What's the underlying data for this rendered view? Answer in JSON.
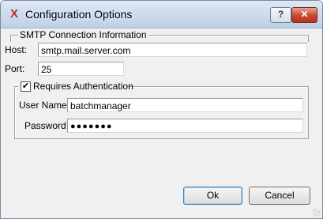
{
  "window": {
    "title": "Configuration Options",
    "help_label": "?",
    "close_label": "✕"
  },
  "smtp": {
    "legend": "SMTP Connection Information",
    "host_label": "Host:",
    "host_value": "smtp.mail.server.com",
    "port_label": "Port:",
    "port_value": "25"
  },
  "auth": {
    "legend": "Requires Authentication",
    "checked": true,
    "check_mark": "✔",
    "username_label": "User Name:",
    "username_value": "batchmanager",
    "password_label": "Password:",
    "password_value": "●●●●●●●"
  },
  "buttons": {
    "ok_label": "Ok",
    "cancel_label": "Cancel"
  }
}
